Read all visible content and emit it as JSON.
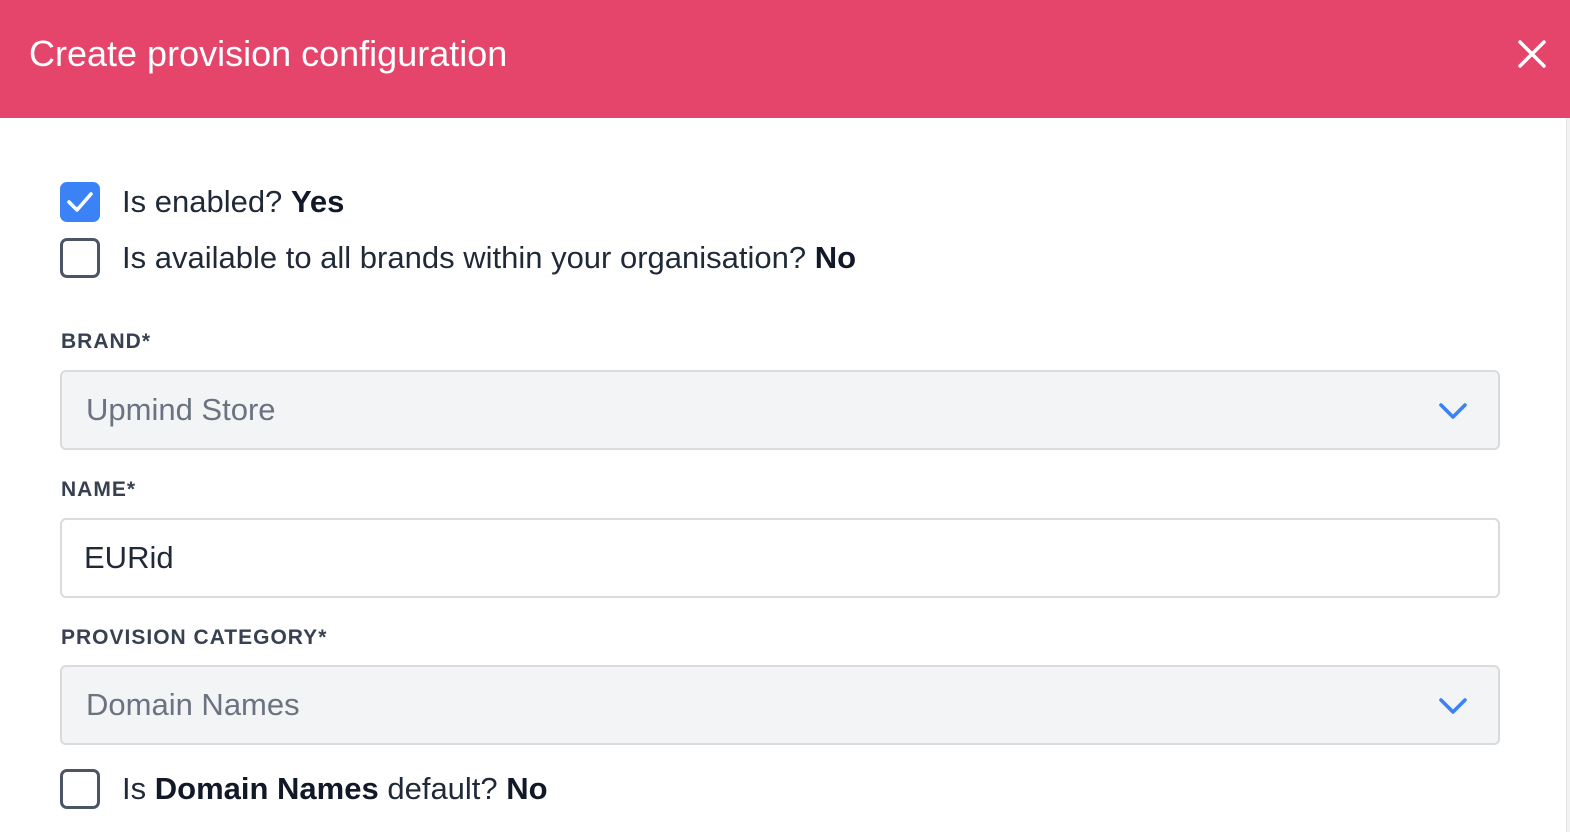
{
  "modal": {
    "title": "Create provision configuration"
  },
  "toggles": {
    "enabled": {
      "label": "Is enabled?",
      "value": "Yes",
      "checked": true
    },
    "all_brands": {
      "label": "Is available to all brands within your organisation?",
      "value": "No",
      "checked": false
    },
    "category_default": {
      "prefix": "Is",
      "category": "Domain Names",
      "suffix": "default?",
      "value": "No",
      "checked": false
    }
  },
  "fields": {
    "brand": {
      "label": "BRAND*",
      "selected": "Upmind Store"
    },
    "name": {
      "label": "NAME*",
      "value": "EURid"
    },
    "provision_category": {
      "label": "PROVISION CATEGORY*",
      "selected": "Domain Names"
    }
  },
  "icons": {
    "close": "close-icon",
    "check": "checkmark-icon",
    "dropdown": "chevron-down-icon"
  },
  "colors": {
    "header_bg": "#e5456a",
    "accent": "#3b82f6"
  }
}
